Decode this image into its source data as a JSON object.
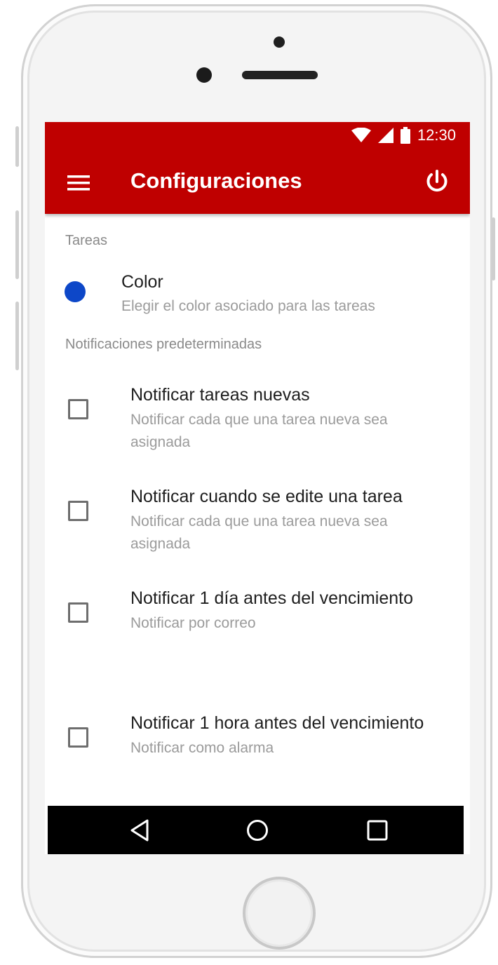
{
  "status_bar": {
    "time": "12:30",
    "icons": [
      "wifi-icon",
      "signal-icon",
      "battery-icon"
    ]
  },
  "toolbar": {
    "title": "Configuraciones",
    "left_icon": "menu-icon",
    "right_icon": "power-icon",
    "background_color": "#bf0000"
  },
  "sections": [
    {
      "header": "Tareas",
      "items": [
        {
          "title": "Color",
          "summary": "Elegir el color asociado para las tareas",
          "color": "#0d47c8"
        }
      ]
    },
    {
      "header": "Notificaciones predeterminadas",
      "items": [
        {
          "title": "Notificar tareas nuevas",
          "summary_line1": "Notificar cada que una tarea nueva sea",
          "summary_line2": "asignada",
          "checked": false
        },
        {
          "title": "Notificar cuando se edite una tarea",
          "summary_line1": "Notificar cada que una tarea nueva sea",
          "summary_line2": "asignada",
          "checked": false
        },
        {
          "title": "Notificar 1 día antes del vencimiento",
          "summary_line1": "Notificar por correo",
          "checked": false
        },
        {
          "title": "Notificar 1 hora antes del vencimiento",
          "summary_line1": "Notificar como alarma",
          "checked": false
        }
      ]
    }
  ],
  "nav_bar": {
    "buttons": [
      "back-icon",
      "home-icon",
      "recents-icon"
    ]
  }
}
